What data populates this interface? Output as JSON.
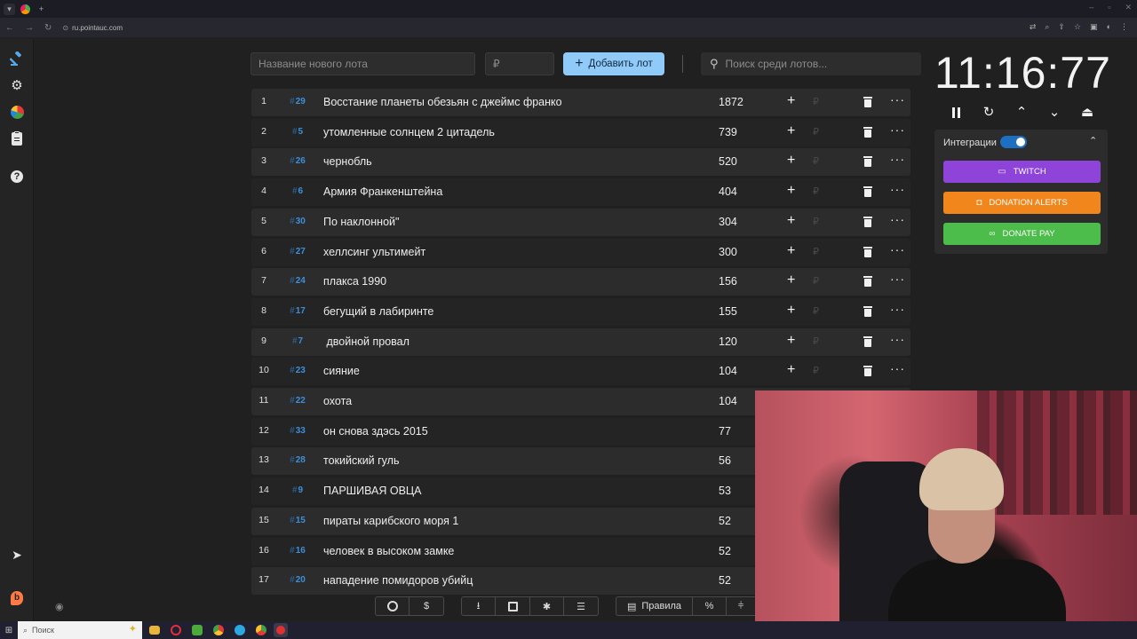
{
  "browser": {
    "url": "ru.pointauc.com"
  },
  "sidebar": {
    "icons": [
      "gavel-icon",
      "gear-icon",
      "pie-chart-icon",
      "clipboard-icon",
      "help-icon",
      "telegram-icon",
      "brand-icon"
    ]
  },
  "toolbar": {
    "lot_placeholder": "Название нового лота",
    "amount_placeholder": "₽",
    "add_button_label": "Добавить лот",
    "search_placeholder": "Поиск среди лотов..."
  },
  "lots": [
    {
      "index": "1",
      "number": "29",
      "name": "Восстание планеты обезьян с джеймс франко",
      "amount": "1872"
    },
    {
      "index": "2",
      "number": "5",
      "name": "утомленные солнцем 2 цитадель",
      "amount": "739"
    },
    {
      "index": "3",
      "number": "26",
      "name": "чернобль",
      "amount": "520"
    },
    {
      "index": "4",
      "number": "6",
      "name": "Армия Франкенштейна",
      "amount": "404"
    },
    {
      "index": "5",
      "number": "30",
      "name": "По наклонной\"",
      "amount": "304"
    },
    {
      "index": "6",
      "number": "27",
      "name": "хеллсинг ультимейт",
      "amount": "300"
    },
    {
      "index": "7",
      "number": "24",
      "name": "плакса 1990",
      "amount": "156"
    },
    {
      "index": "8",
      "number": "17",
      "name": "бегущий в лабиринте",
      "amount": "155"
    },
    {
      "index": "9",
      "number": "7",
      "name": " двойной провал",
      "amount": "120"
    },
    {
      "index": "10",
      "number": "23",
      "name": "сияние",
      "amount": "104"
    },
    {
      "index": "11",
      "number": "22",
      "name": "охота",
      "amount": "104"
    },
    {
      "index": "12",
      "number": "33",
      "name": "он снова здэсь 2015",
      "amount": "77"
    },
    {
      "index": "13",
      "number": "28",
      "name": "токийский гуль",
      "amount": "56"
    },
    {
      "index": "14",
      "number": "9",
      "name": "ПАРШИВАЯ ОВЦА",
      "amount": "53"
    },
    {
      "index": "15",
      "number": "15",
      "name": "пираты карибского моря 1",
      "amount": "52"
    },
    {
      "index": "16",
      "number": "16",
      "name": "человек в высоком замке",
      "amount": "52"
    },
    {
      "index": "17",
      "number": "20",
      "name": "нападение помидоров убийц",
      "amount": "52"
    }
  ],
  "row_symbols": {
    "hash": "#",
    "plus": "+",
    "currency": "₽",
    "more": "···"
  },
  "timer": {
    "value": "11:16:77"
  },
  "integrations": {
    "label": "Интеграции",
    "enabled": true,
    "buttons": [
      {
        "label": "TWITCH",
        "color": "#8e44d9"
      },
      {
        "label": "DONATION ALERTS",
        "color": "#f0861c"
      },
      {
        "label": "DONATE PAY",
        "color": "#4cbc4a"
      }
    ]
  },
  "bottom_toolbar": {
    "rules_label": "Правила"
  },
  "taskbar": {
    "search_label": "Поиск"
  },
  "colors": {
    "accent": "#90caf9",
    "lot_number": "#3d8fd9",
    "background": "#202020"
  }
}
